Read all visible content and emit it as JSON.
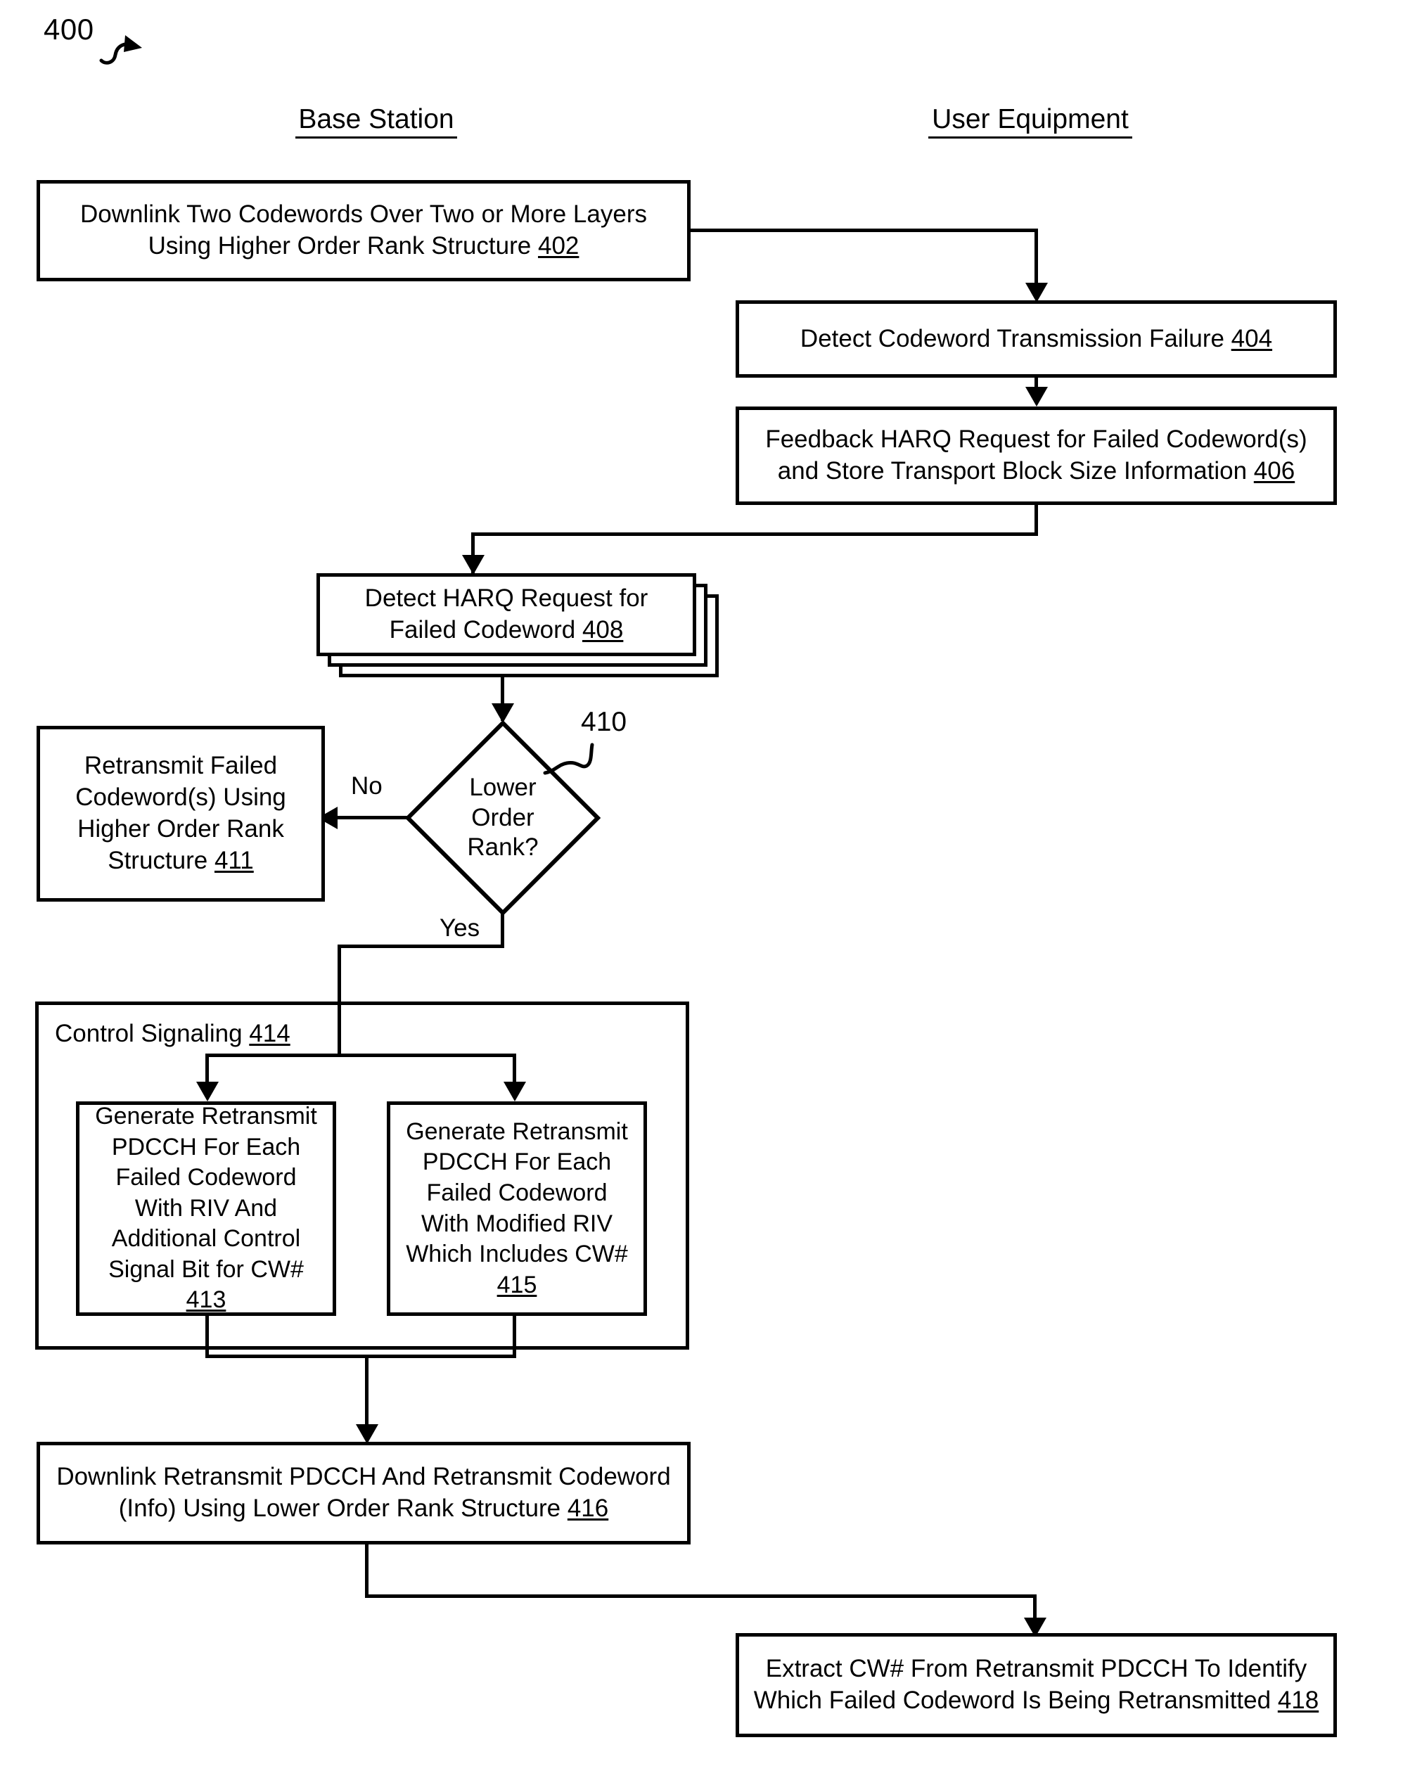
{
  "figure": {
    "number": "400",
    "leader_icon": "curved-arrow-icon"
  },
  "columns": [
    {
      "id": "base-station",
      "label": "Base Station"
    },
    {
      "id": "user-equipment",
      "label": "User Equipment"
    }
  ],
  "nodes": {
    "n402": {
      "ref": "402",
      "lines": [
        "Downlink Two Codewords Over Two or More Layers",
        "Using Higher Order Rank Structure"
      ],
      "column": "base-station",
      "shape": "process"
    },
    "n404": {
      "ref": "404",
      "lines": [
        "Detect Codeword Transmission Failure"
      ],
      "column": "user-equipment",
      "shape": "process"
    },
    "n406": {
      "ref": "406",
      "lines": [
        "Feedback HARQ Request for Failed Codeword(s)",
        "and Store Transport Block Size Information"
      ],
      "column": "user-equipment",
      "shape": "process"
    },
    "n408": {
      "ref": "408",
      "lines": [
        "Detect HARQ Request for",
        "Failed Codeword"
      ],
      "column": "base-station",
      "shape": "stacked-process"
    },
    "n410": {
      "ref": "410",
      "lines": [
        "Lower",
        "Order",
        "Rank?"
      ],
      "column": "base-station",
      "shape": "decision"
    },
    "n411": {
      "ref": "411",
      "lines": [
        "Retransmit Failed",
        "Codeword(s) Using",
        "Higher Order Rank",
        "Structure"
      ],
      "column": "base-station",
      "shape": "process"
    },
    "n414": {
      "ref": "414",
      "label": "Control Signaling",
      "column": "base-station",
      "shape": "group"
    },
    "n413": {
      "ref": "413",
      "lines": [
        "Generate Retransmit",
        "PDCCH For Each",
        "Failed Codeword",
        "With RIV And",
        "Additional Control",
        "Signal Bit for CW#"
      ],
      "column": "base-station",
      "shape": "process"
    },
    "n415": {
      "ref": "415",
      "lines": [
        "Generate Retransmit",
        "PDCCH For Each",
        "Failed Codeword",
        "With Modified RIV",
        "Which Includes CW#"
      ],
      "column": "base-station",
      "shape": "process"
    },
    "n416": {
      "ref": "416",
      "lines": [
        "Downlink Retransmit PDCCH And Retransmit Codeword",
        "(Info) Using Lower Order Rank Structure"
      ],
      "column": "base-station",
      "shape": "process"
    },
    "n418": {
      "ref": "418",
      "lines": [
        "Extract CW# From Retransmit PDCCH To Identify",
        "Which Failed Codeword Is Being Retransmitted"
      ],
      "column": "user-equipment",
      "shape": "process"
    }
  },
  "edge_labels": {
    "no": "No",
    "yes": "Yes"
  },
  "colors": {
    "stroke": "#000000",
    "background": "#ffffff"
  }
}
